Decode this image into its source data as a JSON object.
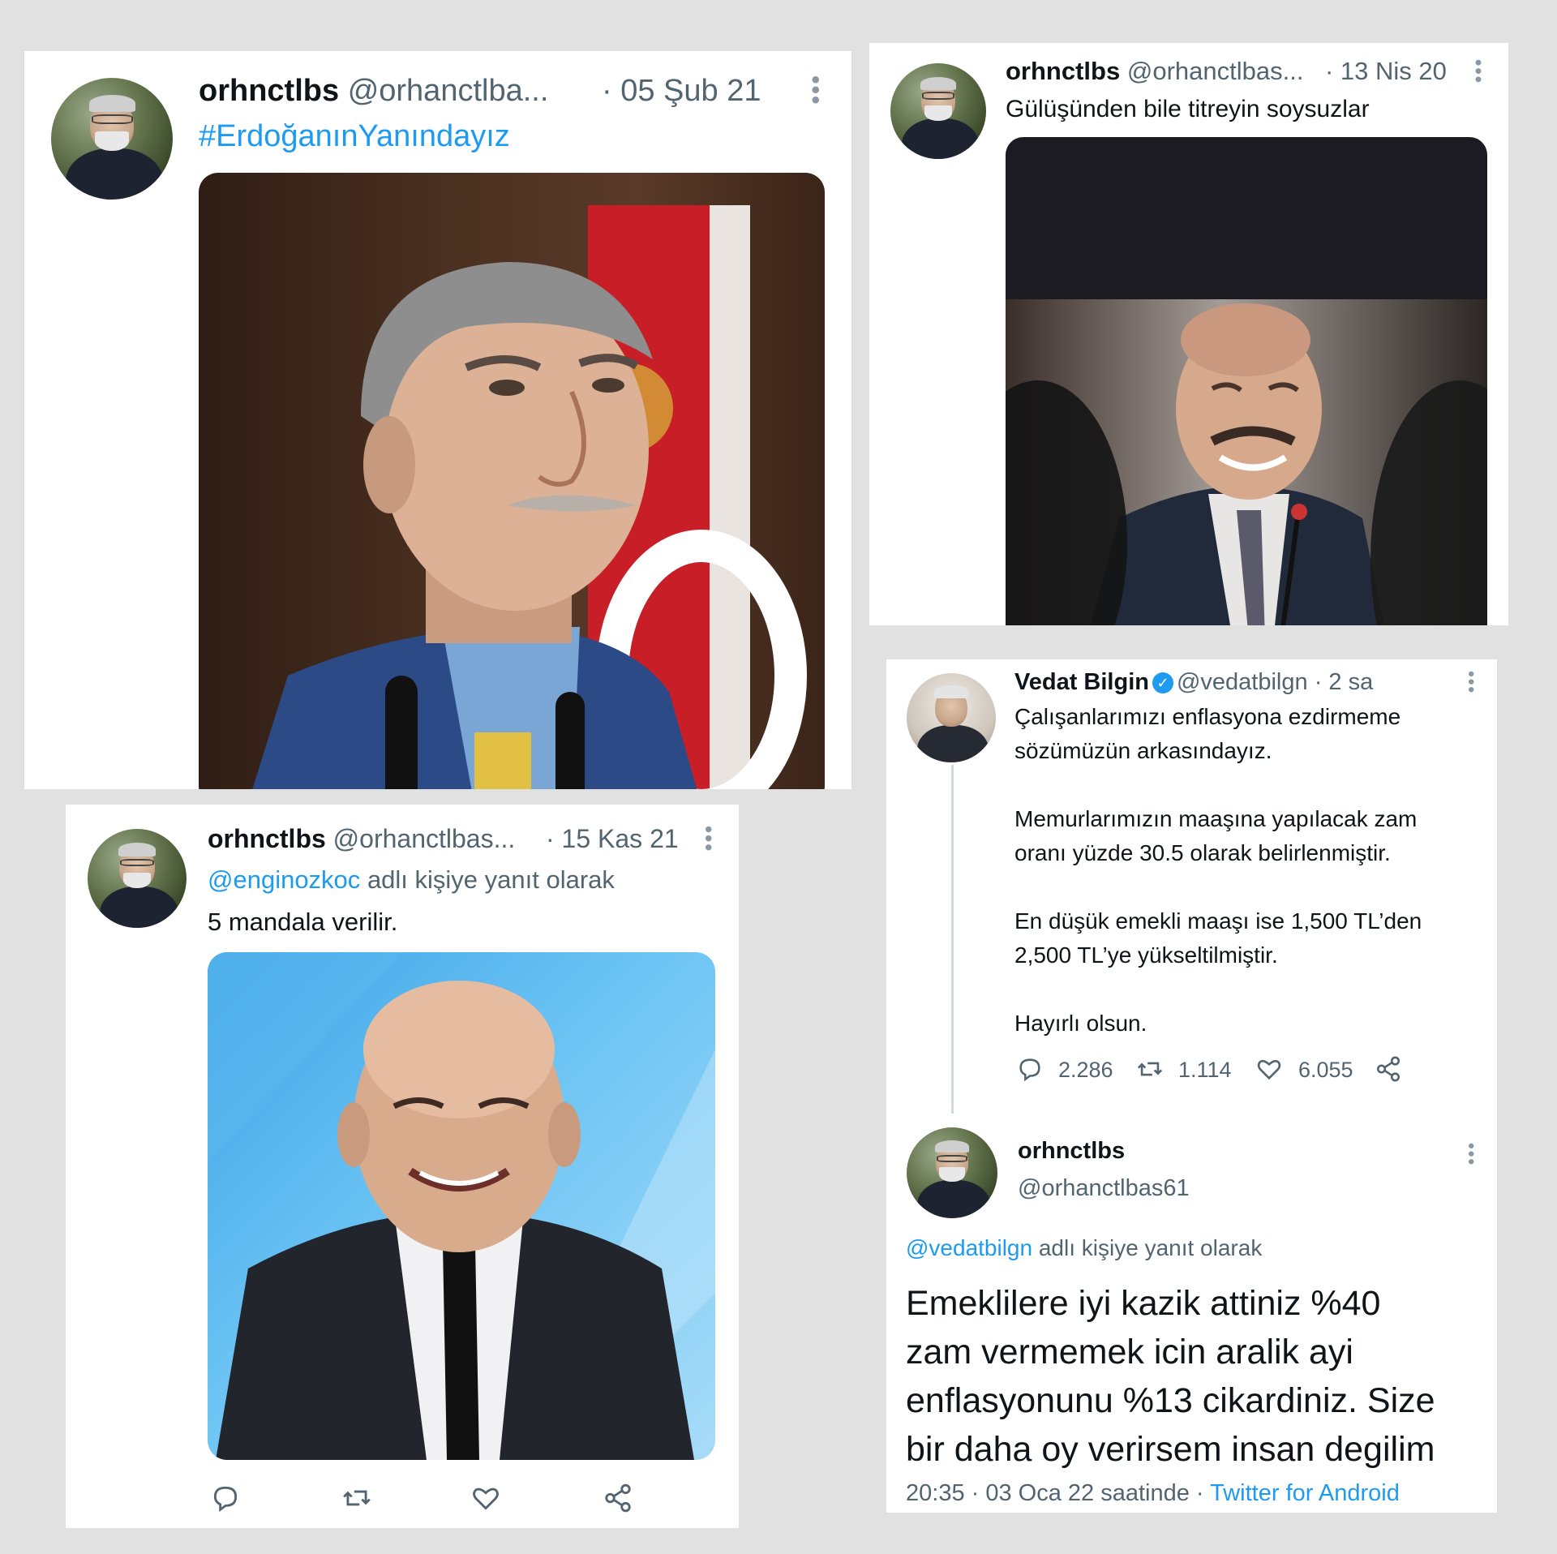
{
  "tweet1": {
    "display_name": "orhnctlbs",
    "handle": "@orhanctlba...",
    "date": "· 05 Şub 21",
    "hashtag": "#ErdoğanınYanındayız"
  },
  "tweet2": {
    "display_name": "orhnctlbs",
    "handle": "@orhanctlbas...",
    "date": "· 13 Nis 20",
    "text": "Gülüşünden bile titreyin soysuzlar"
  },
  "tweet3": {
    "display_name": "orhnctlbs",
    "handle": "@orhanctlbas...",
    "date": "· 15 Kas 21",
    "reply_to_handle": "@enginozkoc",
    "reply_to_suffix": "adlı kişiye yanıt olarak",
    "text": "5 mandala verilir."
  },
  "tweet4": {
    "original": {
      "display_name": "Vedat Bilgin",
      "handle_time": "@vedatbilgn · 2 sa",
      "verified_glyph": "✓",
      "paragraphs": [
        "Çalışanlarımızı enflasyona ezdirmeme",
        "sözümüzün arkasındayız.",
        "Memurlarımızın maaşına yapılacak zam",
        "oranı yüzde 30.5 olarak belirlenmiştir.",
        "En düşük emekli maaşı ise 1,500 TL’den",
        "2,500 TL’ye yükseltilmiştir.",
        "Hayırlı olsun."
      ],
      "stats": {
        "replies": "2.286",
        "retweets": "1.114",
        "likes": "6.055"
      }
    },
    "reply": {
      "display_name": "orhnctlbs",
      "handle": "@orhanctlbas61",
      "reply_to_handle": "@vedatbilgn",
      "reply_to_suffix": "adlı kişiye yanıt olarak",
      "lines": [
        "Emeklilere iyi kazik attiniz %40",
        "zam vermemek icin aralik ayi",
        "enflasyonunu %13 cikardiniz. Size",
        "bir daha oy verirsem insan degilim"
      ],
      "timestamp": "20:35 · 03 Oca 22 saatinde ·",
      "source": "Twitter for Android"
    }
  },
  "colors": {
    "accent": "#1d9bf0",
    "muted": "#536471",
    "page_background": "#e1e1e1"
  }
}
